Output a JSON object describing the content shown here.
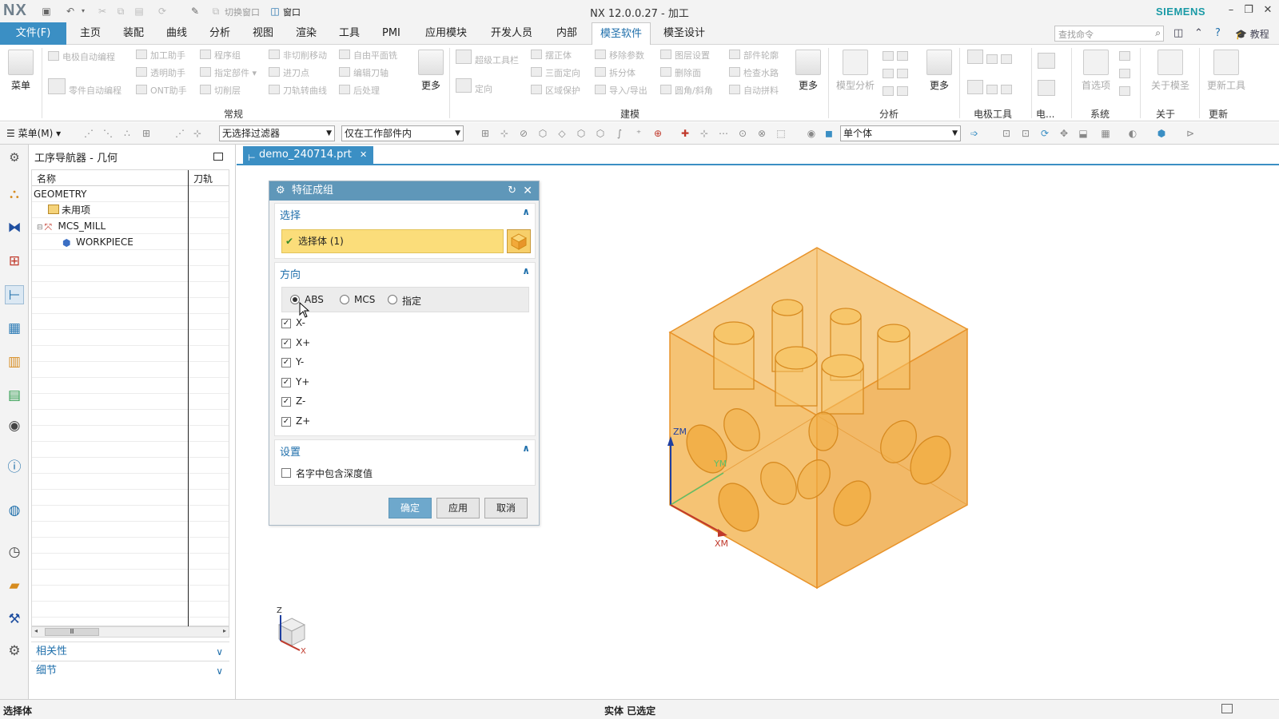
{
  "titlebar": {
    "logo": "NX",
    "title": "NX 12.0.0.27 - 加工",
    "brand": "SIEMENS",
    "switch_window_label": "切换窗口",
    "window_label": "窗口"
  },
  "menubar": {
    "file": "文件(F)",
    "tabs": [
      "主页",
      "装配",
      "曲线",
      "分析",
      "视图",
      "渲染",
      "工具",
      "PMI",
      "应用模块",
      "开发人员",
      "内部",
      "模圣软件",
      "模圣设计"
    ],
    "active_tab": "模圣软件",
    "search_placeholder": "查找命令",
    "tutorial": "教程"
  },
  "ribbon": {
    "menu_label": "菜单",
    "groups": [
      {
        "label": "常规"
      },
      {
        "label": "建模"
      },
      {
        "label": "分析"
      },
      {
        "label": "电极工具"
      },
      {
        "label": "电..."
      },
      {
        "label": "系统"
      },
      {
        "label": "关于"
      },
      {
        "label": "更新"
      }
    ],
    "buttons": [
      "电极自动编程",
      "加工助手",
      "程序组",
      "非切削移动",
      "自由平面铣",
      "零件自动编程",
      "透明助手",
      "指定部件",
      "进刀点",
      "编辑刀轴",
      "ONT助手",
      "切削层",
      "刀轨转曲线",
      "后处理",
      "超级工具栏",
      "摆正体",
      "移除参数",
      "图层设置",
      "部件轮廓",
      "定向",
      "三面定向",
      "拆分体",
      "删除面",
      "检查水路",
      "区域保护",
      "导入/导出",
      "圆角/斜角",
      "自动拼料"
    ],
    "more_label": "更多",
    "model_analysis": "模型分析",
    "first_item": "首选项",
    "about_mosheng": "关于模圣",
    "update_tool": "更新工具"
  },
  "toolbar2": {
    "menu_dropdown": "菜单(M)",
    "filter_select": "无选择过滤器",
    "scope_select": "仅在工作部件内",
    "body_select": "单个体"
  },
  "navigator": {
    "title": "工序导航器 - 几何",
    "col_name": "名称",
    "col_toolpath": "刀轨",
    "rows": [
      "GEOMETRY",
      "未用项",
      "MCS_MILL",
      "WORKPIECE"
    ],
    "section_relations": "相关性",
    "section_details": "细节"
  },
  "graphics": {
    "doc_tab": "demo_240714.prt",
    "axis_zm": "ZM",
    "axis_ym": "YM",
    "axis_xm": "XM",
    "triad_z": "Z",
    "triad_x": "X"
  },
  "dialog": {
    "title": "特征成组",
    "section_select": "选择",
    "select_body": "选择体 (1)",
    "section_direction": "方向",
    "radio_abs": "ABS",
    "radio_mcs": "MCS",
    "radio_specify": "指定",
    "checks": [
      "X-",
      "X+",
      "Y-",
      "Y+",
      "Z-",
      "Z+"
    ],
    "section_settings": "设置",
    "depth_in_name": "名字中包含深度值",
    "ok": "确定",
    "apply": "应用",
    "cancel": "取消"
  },
  "status": {
    "left": "选择体",
    "middle": "实体 已选定"
  },
  "colors": {
    "accent": "#3b8fc4",
    "dialog_header": "#5f97b9",
    "selection_highlight": "#fbdd7a",
    "part_fill": "#f3b85c",
    "part_edge": "#e8932a"
  }
}
